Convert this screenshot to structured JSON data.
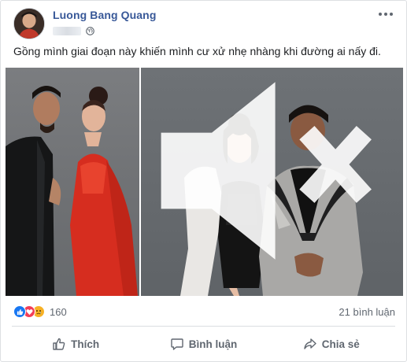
{
  "post": {
    "author": "Luong Bang Quang",
    "text": "Gồng mình giai đoạn này khiến mình cư xử nhẹ nhàng khi đường ai nấy đi.",
    "privacy_icon": "globe-icon",
    "menu_icon": "more-dots-icon"
  },
  "media": {
    "photos": [
      {
        "name": "photo-left",
        "subject": "couple-red-dress"
      },
      {
        "name": "photo-right",
        "subject": "couple-black-dress"
      }
    ],
    "mute_icon": "volume-muted-icon"
  },
  "reactions": {
    "icons": [
      "like-reaction-icon",
      "love-reaction-icon",
      "sad-reaction-icon"
    ],
    "count": "160",
    "comments": "21 bình luận"
  },
  "actions": {
    "like": "Thích",
    "comment": "Bình luận",
    "share": "Chia sẻ"
  },
  "colors": {
    "author_link": "#385898",
    "meta_gray": "#606770",
    "like_blue": "#1877f2",
    "love_red": "#f33e58",
    "sad_yellow": "#f7b125"
  }
}
